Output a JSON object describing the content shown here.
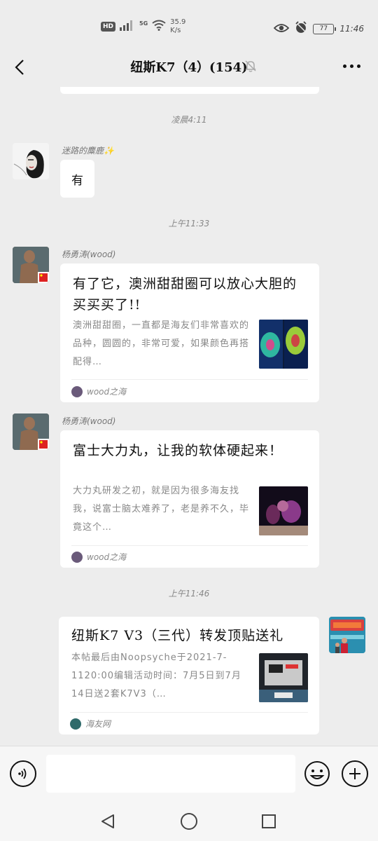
{
  "status_bar": {
    "hd": "HD",
    "network": "5G",
    "speed_value": "35.9",
    "speed_unit": "K/s",
    "battery": "77",
    "time": "11:46"
  },
  "header": {
    "title": "纽斯K7（4）(154)",
    "back_icon": "chevron-left-icon",
    "mute_icon": "bell-off-icon",
    "more_icon": "more-dots-icon"
  },
  "messages": [
    {
      "type": "timestamp",
      "text": "凌晨4:11"
    },
    {
      "type": "text",
      "sender": "迷路的麋鹿✨",
      "text": "有"
    },
    {
      "type": "timestamp",
      "text": "上午11:33"
    },
    {
      "type": "link",
      "sender": "杨勇涛(wood)",
      "title": "有了它，澳洲甜甜圈可以放心大胆的买买买了!!",
      "desc": "澳洲甜甜圈，一直都是海友们非常喜欢的品种，圆圆的，非常可爱，如果颜色再搭配得…",
      "source": "wood之海"
    },
    {
      "type": "link",
      "sender": "杨勇涛(wood)",
      "title": "富士大力丸，让我的软体硬起来！",
      "desc": "大力丸研发之初，就是因为很多海友找我，说富士脑太难养了，老是养不久，毕竟这个…",
      "source": "wood之海"
    },
    {
      "type": "timestamp",
      "text": "上午11:46"
    },
    {
      "type": "link",
      "sender": "self",
      "title": "纽斯K7 V3（三代）转发顶贴送礼",
      "desc": "本帖最后由Noopsyche于2021-7-1120:00编辑活动时间：7月5日到7月14日送2套K7V3（…",
      "source": "海友网"
    }
  ],
  "input_bar": {
    "voice_icon": "voice-icon",
    "emoji_icon": "emoji-icon",
    "plus_icon": "plus-icon"
  },
  "nav": {
    "back": "nav-back-icon",
    "home": "nav-home-icon",
    "recent": "nav-recent-icon"
  },
  "colors": {
    "background": "#ededed",
    "bubble": "#ffffff",
    "muted_text": "#888888"
  }
}
